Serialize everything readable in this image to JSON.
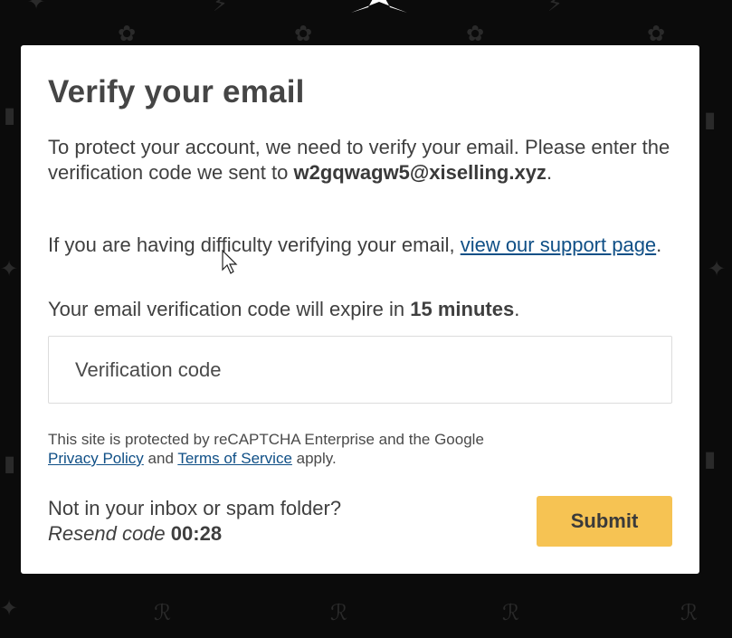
{
  "modal": {
    "title": "Verify your email",
    "intro_text": "To protect your account, we need to verify your email. Please enter the verification code we sent to",
    "email": "w2gqwagw5@xiselling.xyz",
    "intro_end": ".",
    "support_prefix": "If you are having difficulty verifying your email, ",
    "support_link": "view our support page",
    "support_end": ".",
    "expire_prefix": "Your email verification code will expire in ",
    "expire_value": "15 minutes",
    "expire_end": ".",
    "code_placeholder": "Verification code",
    "recaptcha_text": "This site is protected by reCAPTCHA Enterprise and the Google",
    "privacy_link": "Privacy Policy",
    "and_text": " and ",
    "terms_link": "Terms of Service",
    "apply_text": " apply.",
    "inbox_text": "Not in your inbox or spam folder?",
    "resend_label": "Resend code",
    "resend_timer": "00:28",
    "submit_label": "Submit"
  },
  "icons": {
    "background_pattern": "decorative-pattern-icon",
    "logo": "star-logo-icon",
    "cursor": "mouse-pointer-icon"
  },
  "colors": {
    "background": "#0b0b0b",
    "modal": "#ffffff",
    "link": "#0f4f86",
    "submit": "#f6c353"
  }
}
